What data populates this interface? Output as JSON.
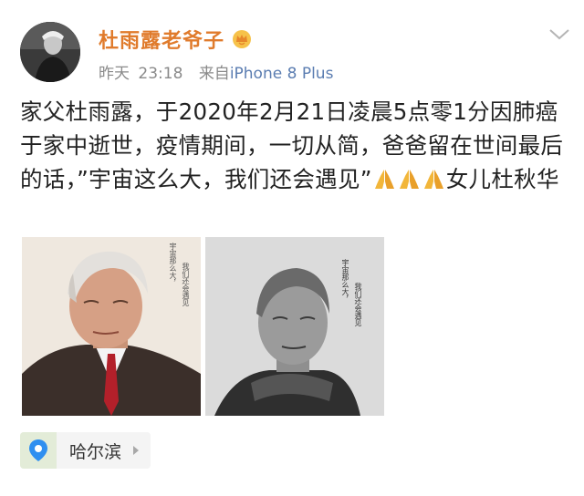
{
  "post": {
    "username": "杜雨露老爷子",
    "date": "昨天",
    "time": "23:18",
    "source_prefix": "来自",
    "source_device": "iPhone 8 Plus",
    "text_before_quote": "家父杜雨露，于2020年2月21日凌晨5点零1分因肺癌于家中逝世，疫情期间，一切从简，爸爸留在世间最后的话，",
    "quote": "”宇宙这么大，我们还会遇见”",
    "text_after": "女儿杜秋华",
    "emoji_count": 3,
    "images": [
      {
        "vertical_text": [
          "宇宙那么大，",
          "我们还会遇见"
        ]
      },
      {
        "vertical_text": [
          "宇宙那么大，",
          "我们还会遇见"
        ]
      }
    ],
    "location": {
      "name": "哈尔滨"
    }
  },
  "colors": {
    "username": "#e07b2c",
    "link": "#5b7db1",
    "meta": "#8a8a8a",
    "emoji": "#f2b63a"
  },
  "icons": {
    "badge": "vip-crown-icon",
    "dropdown": "chevron-down-icon",
    "emoji": "praying-hands-emoji",
    "location": "map-pin-icon",
    "arrow": "chevron-right-icon"
  }
}
